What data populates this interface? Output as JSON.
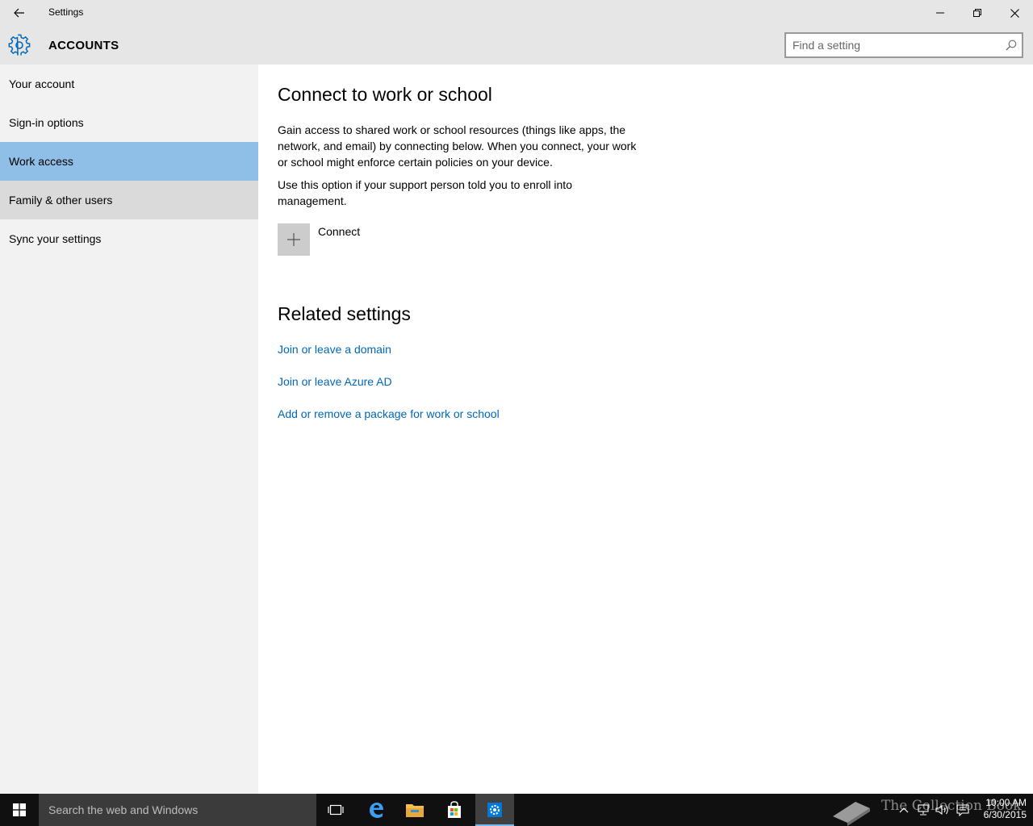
{
  "window": {
    "title": "Settings"
  },
  "header": {
    "section_title": "ACCOUNTS",
    "search_placeholder": "Find a setting"
  },
  "sidebar": {
    "items": [
      {
        "label": "Your account"
      },
      {
        "label": "Sign-in options"
      },
      {
        "label": "Work access",
        "state": "selected"
      },
      {
        "label": "Family & other users",
        "state": "hover"
      },
      {
        "label": "Sync your settings"
      }
    ]
  },
  "main": {
    "title": "Connect to work or school",
    "paragraph1": "Gain access to shared work or school resources (things like apps, the network, and email) by connecting below. When you connect, your work or school might enforce certain policies on your device.",
    "paragraph2": "Use this option if your support person told you to enroll into management.",
    "connect_label": "Connect",
    "related_title": "Related settings",
    "links": [
      {
        "label": "Join or leave a domain"
      },
      {
        "label": "Join or leave Azure AD"
      },
      {
        "label": "Add or remove a package for work or school"
      }
    ]
  },
  "taskbar": {
    "search_text": "Search the web and Windows",
    "watermark_text": "The Collection Book",
    "time": "10:00 AM",
    "date": "6/30/2015",
    "icons": [
      "task-view-icon",
      "edge-icon",
      "file-explorer-icon",
      "store-icon",
      "settings-app-icon"
    ]
  },
  "colors": {
    "accent": "#0067b8",
    "selected_nav": "#8fbfe6",
    "hover_nav": "#dadada",
    "chrome": "#e6e6e6",
    "sidebar": "#f2f2f2",
    "taskbar": "#101010"
  }
}
